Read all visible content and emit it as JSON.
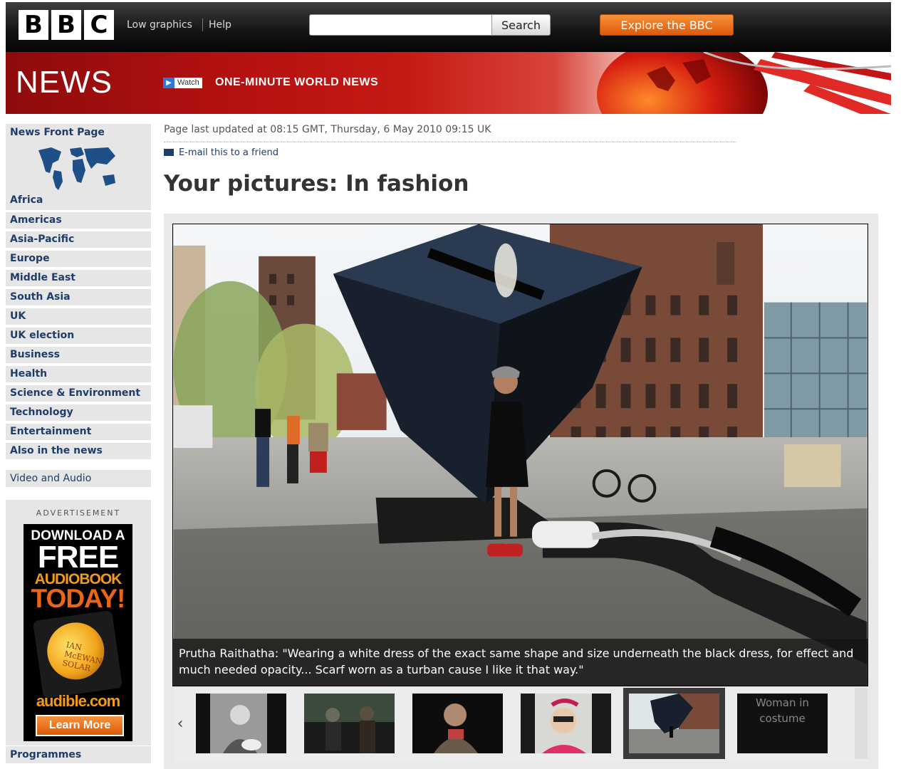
{
  "header": {
    "logo_letters": [
      "B",
      "B",
      "C"
    ],
    "links": {
      "low_graphics": "Low graphics",
      "help": "Help"
    },
    "search": {
      "value": "",
      "button_label": "Search"
    },
    "explore_label": "Explore the BBC"
  },
  "banner": {
    "section_title": "NEWS",
    "watch_label": "Watch",
    "watch_title": "ONE-MINUTE WORLD NEWS"
  },
  "sidebar": {
    "front_page": "News Front Page",
    "africa": "Africa",
    "items": [
      "Americas",
      "Asia-Pacific",
      "Europe",
      "Middle East",
      "South Asia",
      "UK",
      "UK election",
      "Business",
      "Health",
      "Science & Environment",
      "Technology",
      "Entertainment",
      "Also in the news"
    ],
    "video_audio": "Video and Audio",
    "programmes": "Programmes"
  },
  "advert": {
    "label": "ADVERTISEMENT",
    "line1": "DOWNLOAD A",
    "line2": "FREE",
    "line3": "AUDIOBOOK",
    "line4": "TODAY!",
    "book": "IAN McEWAN SOLAR",
    "brand": "audible.com",
    "cta": "Learn More"
  },
  "article": {
    "updated": "Page last updated at 08:15 GMT, Thursday, 6 May 2010 09:15 UK",
    "email_link": "E-mail this to a friend",
    "headline": "Your pictures: In fashion",
    "caption": "Prutha Raithatha: \"Wearing a white dress of the exact same shape and size underneath the black dress, for effect and much needed opacity... Scarf worn as a turban cause I like it that way.\""
  },
  "gallery": {
    "prev_arrow": "‹",
    "last_thumb_text": "Woman in costume",
    "selected_index": 4
  },
  "colors": {
    "nav_text": "#1e3d6a",
    "banner_red": "#c41a14",
    "explore_orange": "#f07a1f"
  }
}
